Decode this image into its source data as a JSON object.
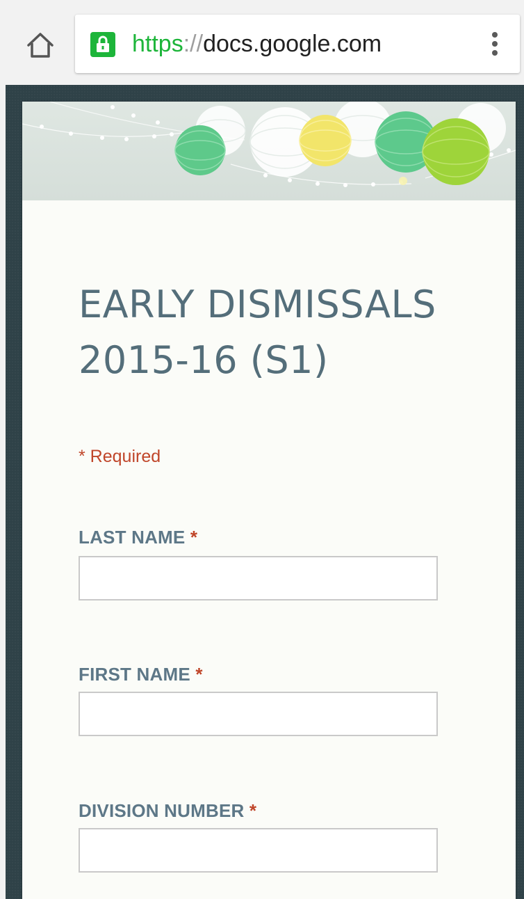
{
  "browser": {
    "url_scheme": "https",
    "url_separator": "://",
    "url_host": "docs.google.com"
  },
  "form": {
    "title": "EARLY DISMISSALS 2015-16 (S1)",
    "required_note": "* Required",
    "fields": [
      {
        "label": "LAST NAME",
        "required_mark": "*",
        "value": ""
      },
      {
        "label": "FIRST NAME",
        "required_mark": "*",
        "value": ""
      },
      {
        "label": "DIVISION NUMBER",
        "required_mark": "*",
        "value": ""
      }
    ]
  },
  "colors": {
    "secure_green": "#1db53a",
    "title_slate": "#546e7a",
    "required_red": "#c0462a",
    "page_background": "#2f4248"
  },
  "icons": [
    "home-icon",
    "lock-icon",
    "overflow-menu-icon",
    "paper-lantern-icon"
  ]
}
